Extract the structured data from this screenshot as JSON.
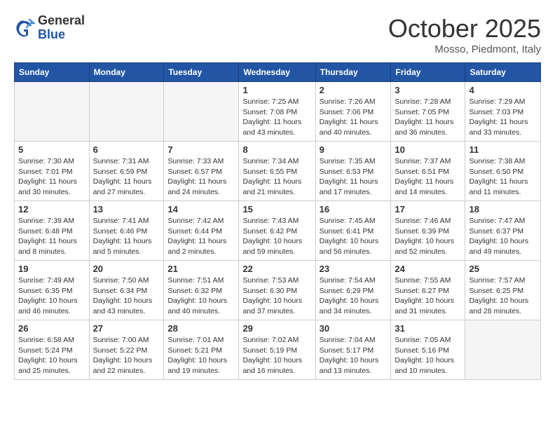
{
  "header": {
    "logo_general": "General",
    "logo_blue": "Blue",
    "month_title": "October 2025",
    "location": "Mosso, Piedmont, Italy"
  },
  "days_of_week": [
    "Sunday",
    "Monday",
    "Tuesday",
    "Wednesday",
    "Thursday",
    "Friday",
    "Saturday"
  ],
  "weeks": [
    [
      {
        "day": "",
        "info": ""
      },
      {
        "day": "",
        "info": ""
      },
      {
        "day": "",
        "info": ""
      },
      {
        "day": "1",
        "info": "Sunrise: 7:25 AM\nSunset: 7:08 PM\nDaylight: 11 hours and 43 minutes."
      },
      {
        "day": "2",
        "info": "Sunrise: 7:26 AM\nSunset: 7:06 PM\nDaylight: 11 hours and 40 minutes."
      },
      {
        "day": "3",
        "info": "Sunrise: 7:28 AM\nSunset: 7:05 PM\nDaylight: 11 hours and 36 minutes."
      },
      {
        "day": "4",
        "info": "Sunrise: 7:29 AM\nSunset: 7:03 PM\nDaylight: 11 hours and 33 minutes."
      }
    ],
    [
      {
        "day": "5",
        "info": "Sunrise: 7:30 AM\nSunset: 7:01 PM\nDaylight: 11 hours and 30 minutes."
      },
      {
        "day": "6",
        "info": "Sunrise: 7:31 AM\nSunset: 6:59 PM\nDaylight: 11 hours and 27 minutes."
      },
      {
        "day": "7",
        "info": "Sunrise: 7:33 AM\nSunset: 6:57 PM\nDaylight: 11 hours and 24 minutes."
      },
      {
        "day": "8",
        "info": "Sunrise: 7:34 AM\nSunset: 6:55 PM\nDaylight: 11 hours and 21 minutes."
      },
      {
        "day": "9",
        "info": "Sunrise: 7:35 AM\nSunset: 6:53 PM\nDaylight: 11 hours and 17 minutes."
      },
      {
        "day": "10",
        "info": "Sunrise: 7:37 AM\nSunset: 6:51 PM\nDaylight: 11 hours and 14 minutes."
      },
      {
        "day": "11",
        "info": "Sunrise: 7:38 AM\nSunset: 6:50 PM\nDaylight: 11 hours and 11 minutes."
      }
    ],
    [
      {
        "day": "12",
        "info": "Sunrise: 7:39 AM\nSunset: 6:48 PM\nDaylight: 11 hours and 8 minutes."
      },
      {
        "day": "13",
        "info": "Sunrise: 7:41 AM\nSunset: 6:46 PM\nDaylight: 11 hours and 5 minutes."
      },
      {
        "day": "14",
        "info": "Sunrise: 7:42 AM\nSunset: 6:44 PM\nDaylight: 11 hours and 2 minutes."
      },
      {
        "day": "15",
        "info": "Sunrise: 7:43 AM\nSunset: 6:42 PM\nDaylight: 10 hours and 59 minutes."
      },
      {
        "day": "16",
        "info": "Sunrise: 7:45 AM\nSunset: 6:41 PM\nDaylight: 10 hours and 56 minutes."
      },
      {
        "day": "17",
        "info": "Sunrise: 7:46 AM\nSunset: 6:39 PM\nDaylight: 10 hours and 52 minutes."
      },
      {
        "day": "18",
        "info": "Sunrise: 7:47 AM\nSunset: 6:37 PM\nDaylight: 10 hours and 49 minutes."
      }
    ],
    [
      {
        "day": "19",
        "info": "Sunrise: 7:49 AM\nSunset: 6:35 PM\nDaylight: 10 hours and 46 minutes."
      },
      {
        "day": "20",
        "info": "Sunrise: 7:50 AM\nSunset: 6:34 PM\nDaylight: 10 hours and 43 minutes."
      },
      {
        "day": "21",
        "info": "Sunrise: 7:51 AM\nSunset: 6:32 PM\nDaylight: 10 hours and 40 minutes."
      },
      {
        "day": "22",
        "info": "Sunrise: 7:53 AM\nSunset: 6:30 PM\nDaylight: 10 hours and 37 minutes."
      },
      {
        "day": "23",
        "info": "Sunrise: 7:54 AM\nSunset: 6:29 PM\nDaylight: 10 hours and 34 minutes."
      },
      {
        "day": "24",
        "info": "Sunrise: 7:55 AM\nSunset: 6:27 PM\nDaylight: 10 hours and 31 minutes."
      },
      {
        "day": "25",
        "info": "Sunrise: 7:57 AM\nSunset: 6:25 PM\nDaylight: 10 hours and 28 minutes."
      }
    ],
    [
      {
        "day": "26",
        "info": "Sunrise: 6:58 AM\nSunset: 5:24 PM\nDaylight: 10 hours and 25 minutes."
      },
      {
        "day": "27",
        "info": "Sunrise: 7:00 AM\nSunset: 5:22 PM\nDaylight: 10 hours and 22 minutes."
      },
      {
        "day": "28",
        "info": "Sunrise: 7:01 AM\nSunset: 5:21 PM\nDaylight: 10 hours and 19 minutes."
      },
      {
        "day": "29",
        "info": "Sunrise: 7:02 AM\nSunset: 5:19 PM\nDaylight: 10 hours and 16 minutes."
      },
      {
        "day": "30",
        "info": "Sunrise: 7:04 AM\nSunset: 5:17 PM\nDaylight: 10 hours and 13 minutes."
      },
      {
        "day": "31",
        "info": "Sunrise: 7:05 AM\nSunset: 5:16 PM\nDaylight: 10 hours and 10 minutes."
      },
      {
        "day": "",
        "info": ""
      }
    ]
  ]
}
